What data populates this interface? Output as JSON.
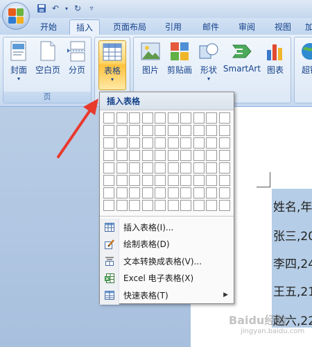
{
  "tabs": [
    "开始",
    "插入",
    "页面布局",
    "引用",
    "邮件",
    "审阅",
    "视图",
    "加"
  ],
  "active_tab": "插入",
  "ribbon": {
    "pages_group": {
      "label": "页",
      "buttons": [
        "封面",
        "空白页",
        "分页"
      ]
    },
    "table_button": "表格",
    "illustrations": [
      "图片",
      "剪贴画",
      "形状",
      "SmartArt",
      "图表"
    ],
    "links_partial": "超链"
  },
  "menu": {
    "header": "插入表格",
    "grid": {
      "cols": 10,
      "rows": 8
    },
    "items": [
      {
        "label": "插入表格(I)...",
        "icon": "insert-table-icon"
      },
      {
        "label": "绘制表格(D)",
        "icon": "draw-table-icon"
      },
      {
        "label": "文本转换成表格(V)...",
        "icon": "text-to-table-icon"
      },
      {
        "label": "Excel 电子表格(X)",
        "icon": "excel-icon"
      },
      {
        "label": "快速表格(T)",
        "icon": "quick-table-icon",
        "submenu": true
      }
    ]
  },
  "document": {
    "lines": [
      "姓名,年",
      "张三,20",
      "李四,24",
      "王五,21",
      "赵六,22"
    ]
  },
  "watermark": {
    "text": "Baidu经验",
    "sub": "jingyan.baidu.com"
  },
  "colors": {
    "accent_red": "#e8392d",
    "ribbon_blue": "#15428b",
    "hot_orange": "#ffc23c"
  }
}
